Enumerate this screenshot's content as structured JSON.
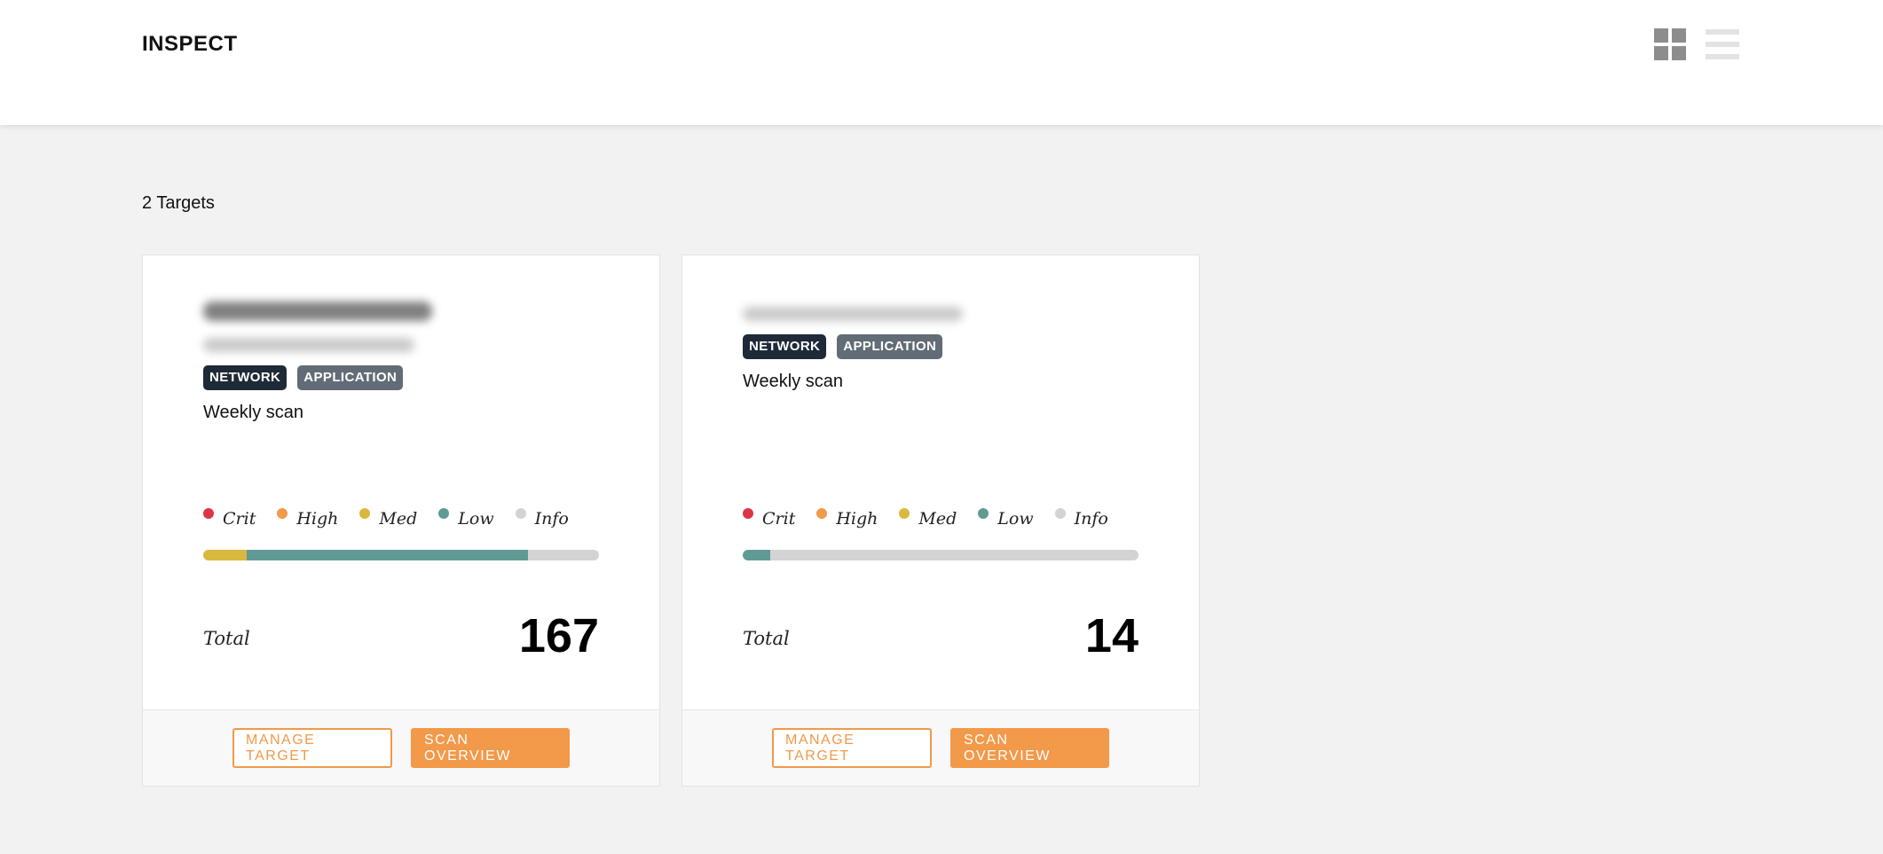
{
  "header": {
    "brand": "INSPECT",
    "view_toggle": {
      "grid_icon": "grid-view-icon",
      "list_icon": "list-view-icon"
    }
  },
  "summary": {
    "count_label": "2 Targets"
  },
  "colors": {
    "crit": "#dc3545",
    "high": "#f2994a",
    "med": "#d9b83e",
    "low": "#5f9b94",
    "info": "#d3d3d3",
    "accent": "#f2994a",
    "tag_network": "#1f2a38",
    "tag_application": "#626c76"
  },
  "legend": [
    "Crit",
    "High",
    "Med",
    "Low",
    "Info"
  ],
  "targets": [
    {
      "tags": [
        "NETWORK",
        "APPLICATION"
      ],
      "schedule": "Weekly scan",
      "severity_fractions": {
        "crit": 0,
        "high": 0,
        "med": 0.11,
        "low": 0.71,
        "info": 0.18
      },
      "total_label": "Total",
      "total": "167",
      "actions": {
        "manage": "MANAGE TARGET",
        "overview": "SCAN OVERVIEW"
      }
    },
    {
      "tags": [
        "NETWORK",
        "APPLICATION"
      ],
      "schedule": "Weekly scan",
      "severity_fractions": {
        "crit": 0,
        "high": 0,
        "med": 0,
        "low": 0.07,
        "info": 0.93
      },
      "total_label": "Total",
      "total": "14",
      "actions": {
        "manage": "MANAGE TARGET",
        "overview": "SCAN OVERVIEW"
      }
    }
  ]
}
